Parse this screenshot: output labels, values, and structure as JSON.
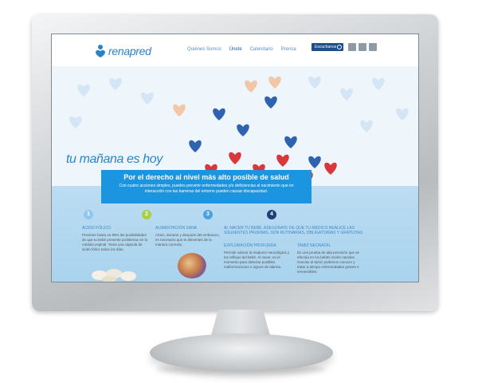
{
  "brand": {
    "name": "renapred",
    "color": "#2c82c9"
  },
  "nav": {
    "items": [
      {
        "label": "Quiénes Somos",
        "active": false
      },
      {
        "label": "Únete",
        "active": true
      },
      {
        "label": "Calendario",
        "active": false
      },
      {
        "label": "Prensa",
        "active": false
      }
    ]
  },
  "header_button": {
    "label": "Escuchanos",
    "icon": "play-icon"
  },
  "social": [
    "facebook-icon",
    "twitter-icon",
    "youtube-icon"
  ],
  "hero": {
    "tagline": "tu mañana es hoy"
  },
  "banner": {
    "title": "Por el derecho al nivel más alto posible de salud",
    "subtitle": "Con cuatro acciones simples, puedes prevenir enfermedades y/o deficiencias al nacimiento que en interacción con las barreras del entorno pueden causar discapacidad."
  },
  "steps": [
    {
      "number": "1",
      "color": "#8fc8ef"
    },
    {
      "number": "2",
      "color": "#a8cf45"
    },
    {
      "number": "3",
      "color": "#4aa3dd"
    },
    {
      "number": "4",
      "color": "#1f3f7a"
    }
  ],
  "columns": [
    {
      "title": "ÁCIDO FÓLICO",
      "text": "Previene hasta un 80% las posibilidades de que tu bebé presente problemas en la médula espinal. Toma una cápsula de ácido fólico todos los días."
    },
    {
      "title": "ALIMENTACIÓN SANA",
      "text": "Antes, durante y después del embarazo, es necesario que te alimentes de la manera correcta."
    },
    {
      "title": "AL NACER TU BEBÉ, ASEGÚRATE DE QUE TU MÉDICO REALICE LAS SIGUIENTES PRUEBAS, SON RUTINARIAS, OBLIGATORIAS Y GRATUITAS",
      "sub1_title": "EXPLORACIÓN PROFUNDA",
      "sub1_text": "Permite valorar la madurez neurológica y los reflejos del bebé. Al nacer, es el momento para detectar posibles malformaciones o signos de alarma.",
      "sub2_title": "TAMIZ NEONATAL",
      "sub2_text": "Es una prueba de alta precisión que se efectúa en los bebés recién nacidos. Gracias al tamiz podemos conocer y tratar a tiempo enfermedades graves e irreversibles."
    }
  ]
}
